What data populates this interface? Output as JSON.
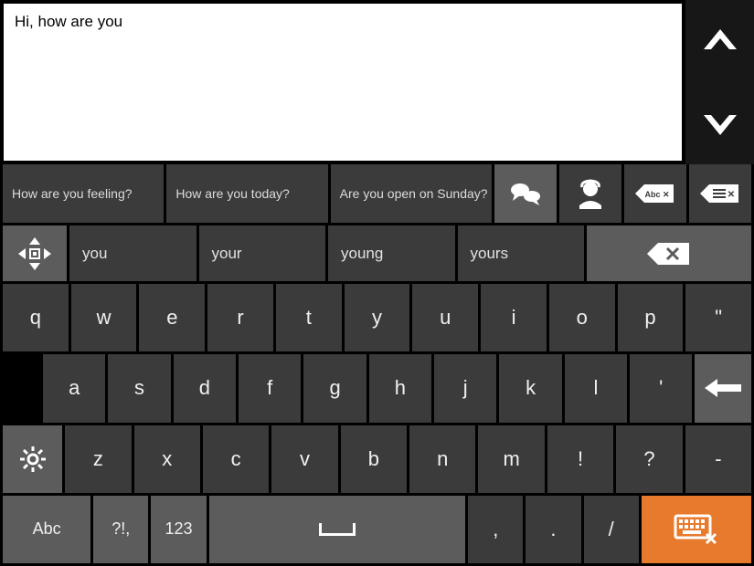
{
  "text_area": {
    "value": "Hi,   how are you"
  },
  "phrases": [
    "How are you feeling?",
    "How are you today?",
    "Are you open on Sunday?"
  ],
  "predictions": [
    "you",
    "your",
    "young",
    "yours"
  ],
  "rows": {
    "r1": [
      "q",
      "w",
      "e",
      "r",
      "t",
      "y",
      "u",
      "i",
      "o",
      "p",
      "\""
    ],
    "r2": [
      "a",
      "s",
      "d",
      "f",
      "g",
      "h",
      "j",
      "k",
      "l",
      "'"
    ],
    "r3": [
      "z",
      "x",
      "c",
      "v",
      "b",
      "n",
      "m",
      "!",
      "?",
      "-"
    ],
    "r4_util": {
      "abc": "Abc",
      "sym": "?!,",
      "num": "123"
    },
    "r4_punct": [
      ",",
      ".",
      "/"
    ]
  },
  "icons": {
    "chat": "chat-icon",
    "agent": "agent-icon",
    "clear_word": "clear-word-icon",
    "clear_line": "clear-line-icon",
    "move": "move-icon",
    "backspace": "backspace-icon",
    "enter": "enter-icon",
    "gear": "gear-icon",
    "close_kb": "close-keyboard-icon",
    "up": "chevron-up-icon",
    "down": "chevron-down-icon",
    "space": "space-icon"
  }
}
